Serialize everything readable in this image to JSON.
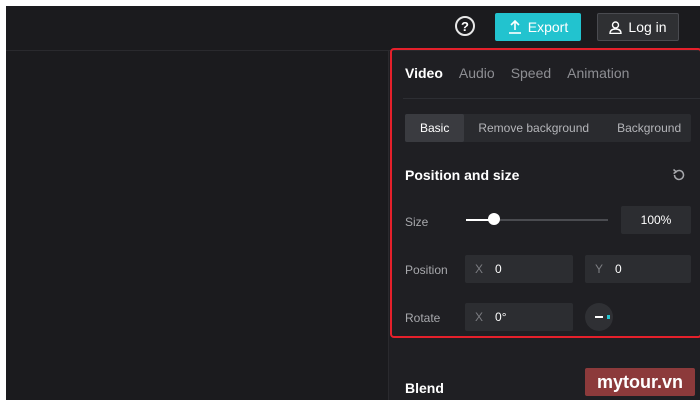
{
  "header": {
    "help_icon": "question-circle-icon",
    "export_label": "Export",
    "login_label": "Log in"
  },
  "panel": {
    "tabs": [
      {
        "label": "Video",
        "active": true
      },
      {
        "label": "Audio",
        "active": false
      },
      {
        "label": "Speed",
        "active": false
      },
      {
        "label": "Animation",
        "active": false
      }
    ],
    "subtabs": [
      {
        "label": "Basic",
        "active": true
      },
      {
        "label": "Remove background",
        "active": false
      },
      {
        "label": "Background",
        "active": false
      }
    ],
    "position_size": {
      "title": "Position and size",
      "size_label": "Size",
      "size_value": "100%",
      "size_slider_fraction": 0.2,
      "position_label": "Position",
      "x_axis": "X",
      "x_value": "0",
      "y_axis": "Y",
      "y_value": "0",
      "rotate_label": "Rotate",
      "rotate_axis": "X",
      "rotate_value": "0°"
    },
    "blend_title": "Blend"
  },
  "colors": {
    "accent": "#22c3cf",
    "highlight_border": "#e5202b",
    "background": "#1b1b1e"
  },
  "watermark": "mytour.vn"
}
